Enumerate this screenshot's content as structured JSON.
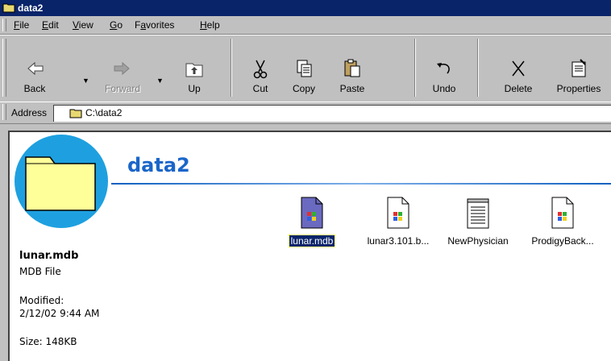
{
  "window": {
    "title": "data2"
  },
  "menu": [
    {
      "label": "File",
      "key": "F"
    },
    {
      "label": "Edit",
      "key": "E"
    },
    {
      "label": "View",
      "key": "V"
    },
    {
      "label": "Go",
      "key": "G"
    },
    {
      "label": "Favorites",
      "key": "a"
    },
    {
      "label": "Help",
      "key": "H"
    }
  ],
  "toolbar": {
    "back": "Back",
    "forward": "Forward",
    "up": "Up",
    "cut": "Cut",
    "copy": "Copy",
    "paste": "Paste",
    "undo": "Undo",
    "delete": "Delete",
    "properties": "Properties"
  },
  "address": {
    "label": "Address",
    "value": "C:\\data2"
  },
  "folder": {
    "name": "data2"
  },
  "details": {
    "name": "lunar.mdb",
    "type": "MDB File",
    "modified_label": "Modified:",
    "modified_value": "2/12/02 9:44 AM",
    "size": "Size: 148KB"
  },
  "files": [
    {
      "name": "lunar.mdb",
      "icon": "mdb-file-icon",
      "selected": true
    },
    {
      "name": "lunar3.101.b...",
      "icon": "windows-file-icon",
      "selected": false
    },
    {
      "name": "NewPhysician",
      "icon": "text-document-icon",
      "selected": false
    },
    {
      "name": "ProdigyBack...",
      "icon": "windows-file-icon",
      "selected": false
    }
  ],
  "colors": {
    "title_bar": "#0a246a",
    "folder_title": "#1b66c9",
    "folder_icon_bg": "#1ea0e0"
  }
}
